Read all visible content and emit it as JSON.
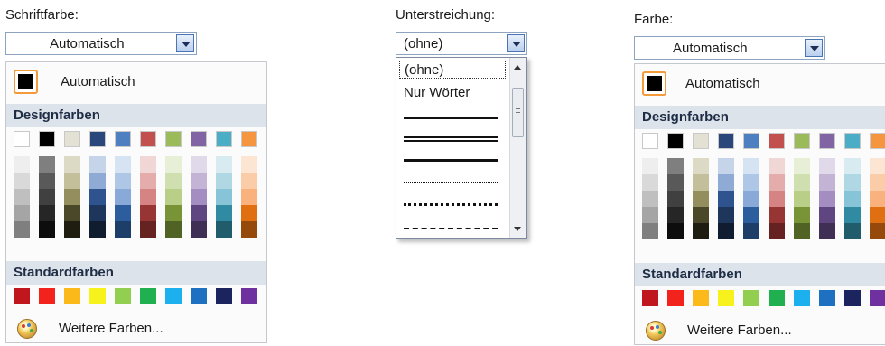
{
  "left_panel": {
    "label": "Schriftfarbe:",
    "combo_value": "Automatisch",
    "automatic_label": "Automatisch",
    "theme_header": "Designfarben",
    "standard_header": "Standardfarben",
    "more_colors": "Weitere Farben..."
  },
  "middle_panel": {
    "label": "Unterstreichung:",
    "combo_value": "(ohne)",
    "items": [
      "(ohne)",
      "Nur Wörter"
    ],
    "line_styles": [
      "single",
      "double",
      "thick",
      "dotted",
      "dotted-heavy",
      "dashed"
    ]
  },
  "right_panel": {
    "label": "Farbe:",
    "combo_value": "Automatisch",
    "automatic_label": "Automatisch",
    "theme_header": "Designfarben",
    "standard_header": "Standardfarben",
    "more_colors": "Weitere Farben..."
  },
  "colors": {
    "theme_top": [
      "#ffffff",
      "#000000",
      "#e3e1d3",
      "#2a477c",
      "#4e7fc1",
      "#c1504e",
      "#9bbb5a",
      "#8064a3",
      "#4badc6",
      "#f59540"
    ],
    "theme_tints": [
      [
        "#eeeeee",
        "#d9d9d9",
        "#bfbfbf",
        "#a5a5a5",
        "#7f7f7f"
      ],
      [
        "#7f7f7f",
        "#595959",
        "#404040",
        "#262626",
        "#0d0d0d"
      ],
      [
        "#dcd9c4",
        "#c4bf9b",
        "#948d5d",
        "#4b4829",
        "#1e1d10"
      ],
      [
        "#c6d4ea",
        "#8eaad5",
        "#2f538e",
        "#1e365c",
        "#101d31"
      ],
      [
        "#d6e3f2",
        "#afc7e6",
        "#89aad8",
        "#2c5d9c",
        "#1d3e68"
      ],
      [
        "#f1d6d6",
        "#e4adac",
        "#d68383",
        "#963533",
        "#652220"
      ],
      [
        "#e7efd7",
        "#d0dfb0",
        "#b9cf88",
        "#799437",
        "#516225"
      ],
      [
        "#e0d9ea",
        "#c3b4d6",
        "#a48ec1",
        "#5f4680",
        "#3f2f55"
      ],
      [
        "#d7ebf1",
        "#afd7e4",
        "#87c4d7",
        "#308aa1",
        "#205c6b"
      ],
      [
        "#fde5d3",
        "#fbcca8",
        "#f9b27d",
        "#e06f12",
        "#954a0c"
      ]
    ],
    "standard": [
      "#c0161d",
      "#f2221c",
      "#fcba1a",
      "#f7f21c",
      "#92cf50",
      "#20b050",
      "#1db0ef",
      "#1d71c0",
      "#1c2460",
      "#7031a0"
    ]
  }
}
